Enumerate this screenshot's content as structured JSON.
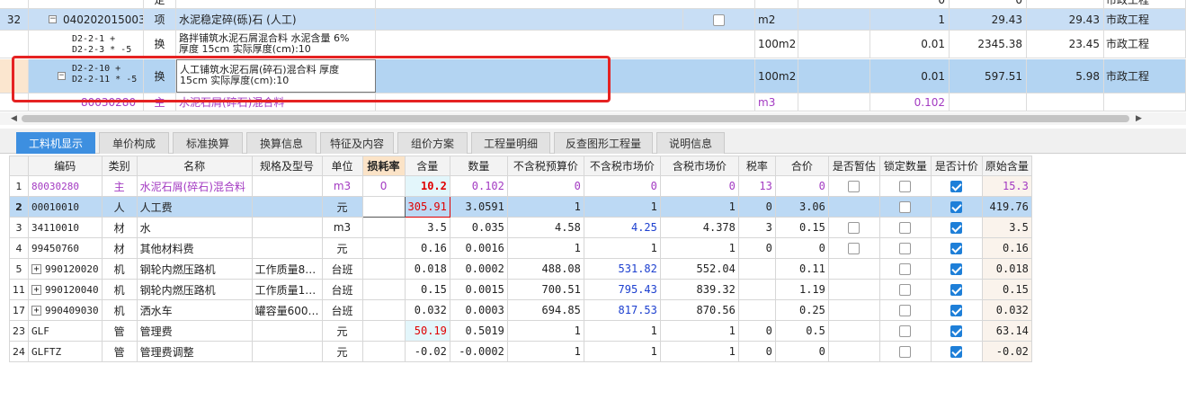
{
  "top": {
    "row0": {
      "unit_cut": "定",
      "v1": "0",
      "v2": "0",
      "prof": "市政工程"
    },
    "row1": {
      "num": "32",
      "code": "040202015003",
      "type": "项",
      "name": "水泥稳定碎(砾)石 (人工)",
      "unit": "m2",
      "qty": "1",
      "price": "29.43",
      "total": "29.43",
      "prof": "市政工程"
    },
    "row2": {
      "code_l1": "D2-2-1 +",
      "code_l2": "D2-2-3 * -5",
      "type": "换",
      "name_l1": "路拌铺筑水泥石屑混合料 水泥含量 6%",
      "name_l2": "厚度 15cm  实际厚度(cm):10",
      "unit": "100m2",
      "qty": "0.01",
      "price": "2345.38",
      "total": "23.45",
      "prof": "市政工程"
    },
    "row3": {
      "code_l1": "D2-2-10 +",
      "code_l2": "D2-2-11 * -5",
      "type": "换",
      "name_l1": "人工铺筑水泥石屑(碎石)混合料 厚度",
      "name_l2": "15cm  实际厚度(cm):10",
      "unit": "100m2",
      "qty": "0.01",
      "price": "597.51",
      "total": "5.98",
      "prof": "市政工程"
    },
    "row4": {
      "code": "80030280",
      "type": "主",
      "name": "水泥石屑(碎石)混合料",
      "unit": "m3",
      "qty": "0.102"
    }
  },
  "tabs": [
    "工料机显示",
    "单价构成",
    "标准换算",
    "换算信息",
    "特征及内容",
    "组价方案",
    "工程量明细",
    "反查图形工程量",
    "说明信息"
  ],
  "grid": {
    "headers": [
      "编码",
      "类别",
      "名称",
      "规格及型号",
      "单位",
      "损耗率",
      "含量",
      "数量",
      "不含税预算价",
      "不含税市场价",
      "含税市场价",
      "税率",
      "合价",
      "是否暂估",
      "锁定数量",
      "是否计价",
      "原始含量"
    ],
    "rows": [
      {
        "idx": "1",
        "code": "80030280",
        "cat": "主",
        "name": "水泥石屑(碎石)混合料",
        "spec": "",
        "unit": "m3",
        "loss": "0",
        "content": "10.2",
        "qty": "0.102",
        "budget": "0",
        "market": "0",
        "taxmarket": "0",
        "rate": "13",
        "total": "0",
        "est": false,
        "lock": false,
        "priced": true,
        "orig": "15.3"
      },
      {
        "idx": "2",
        "code": "00010010",
        "cat": "人",
        "name": "人工费",
        "spec": "",
        "unit": "元",
        "loss": "",
        "content": "305.91",
        "qty": "3.0591",
        "budget": "1",
        "market": "1",
        "taxmarket": "1",
        "rate": "0",
        "total": "3.06",
        "est": null,
        "lock": false,
        "priced": true,
        "orig": "419.76"
      },
      {
        "idx": "3",
        "code": "34110010",
        "cat": "材",
        "name": "水",
        "spec": "",
        "unit": "m3",
        "loss": "",
        "content": "3.5",
        "qty": "0.035",
        "budget": "4.58",
        "market": "4.25",
        "taxmarket": "4.378",
        "rate": "3",
        "total": "0.15",
        "est": false,
        "lock": false,
        "priced": true,
        "orig": "3.5"
      },
      {
        "idx": "4",
        "code": "99450760",
        "cat": "材",
        "name": "其他材料费",
        "spec": "",
        "unit": "元",
        "loss": "",
        "content": "0.16",
        "qty": "0.0016",
        "budget": "1",
        "market": "1",
        "taxmarket": "1",
        "rate": "0",
        "total": "0",
        "est": false,
        "lock": false,
        "priced": true,
        "orig": "0.16"
      },
      {
        "idx": "5",
        "code": "990120020",
        "cat": "机",
        "name": "钢轮内燃压路机",
        "spec": "工作质量8…",
        "unit": "台班",
        "loss": "",
        "content": "0.018",
        "qty": "0.0002",
        "budget": "488.08",
        "market": "531.82",
        "taxmarket": "552.04",
        "rate": "",
        "total": "0.11",
        "est": null,
        "lock": false,
        "priced": true,
        "orig": "0.018"
      },
      {
        "idx": "11",
        "code": "990120040",
        "cat": "机",
        "name": "钢轮内燃压路机",
        "spec": "工作质量1…",
        "unit": "台班",
        "loss": "",
        "content": "0.15",
        "qty": "0.0015",
        "budget": "700.51",
        "market": "795.43",
        "taxmarket": "839.32",
        "rate": "",
        "total": "1.19",
        "est": null,
        "lock": false,
        "priced": true,
        "orig": "0.15"
      },
      {
        "idx": "17",
        "code": "990409030",
        "cat": "机",
        "name": "洒水车",
        "spec": "罐容量600…",
        "unit": "台班",
        "loss": "",
        "content": "0.032",
        "qty": "0.0003",
        "budget": "694.85",
        "market": "817.53",
        "taxmarket": "870.56",
        "rate": "",
        "total": "0.25",
        "est": null,
        "lock": false,
        "priced": true,
        "orig": "0.032"
      },
      {
        "idx": "23",
        "code": "GLF",
        "cat": "管",
        "name": "管理费",
        "spec": "",
        "unit": "元",
        "loss": "",
        "content": "50.19",
        "qty": "0.5019",
        "budget": "1",
        "market": "1",
        "taxmarket": "1",
        "rate": "0",
        "total": "0.5",
        "est": null,
        "lock": false,
        "priced": true,
        "orig": "63.14"
      },
      {
        "idx": "24",
        "code": "GLFTZ",
        "cat": "管",
        "name": "管理费调整",
        "spec": "",
        "unit": "元",
        "loss": "",
        "content": "-0.02",
        "qty": "-0.0002",
        "budget": "1",
        "market": "1",
        "taxmarket": "1",
        "rate": "0",
        "total": "0",
        "est": null,
        "lock": false,
        "priced": true,
        "orig": "-0.02"
      }
    ]
  },
  "colors": {
    "accent": "#3d8fe0",
    "highlight_box": "#e52222",
    "selected_row": "#b3d4f2",
    "main_material": "#a33ac2"
  }
}
